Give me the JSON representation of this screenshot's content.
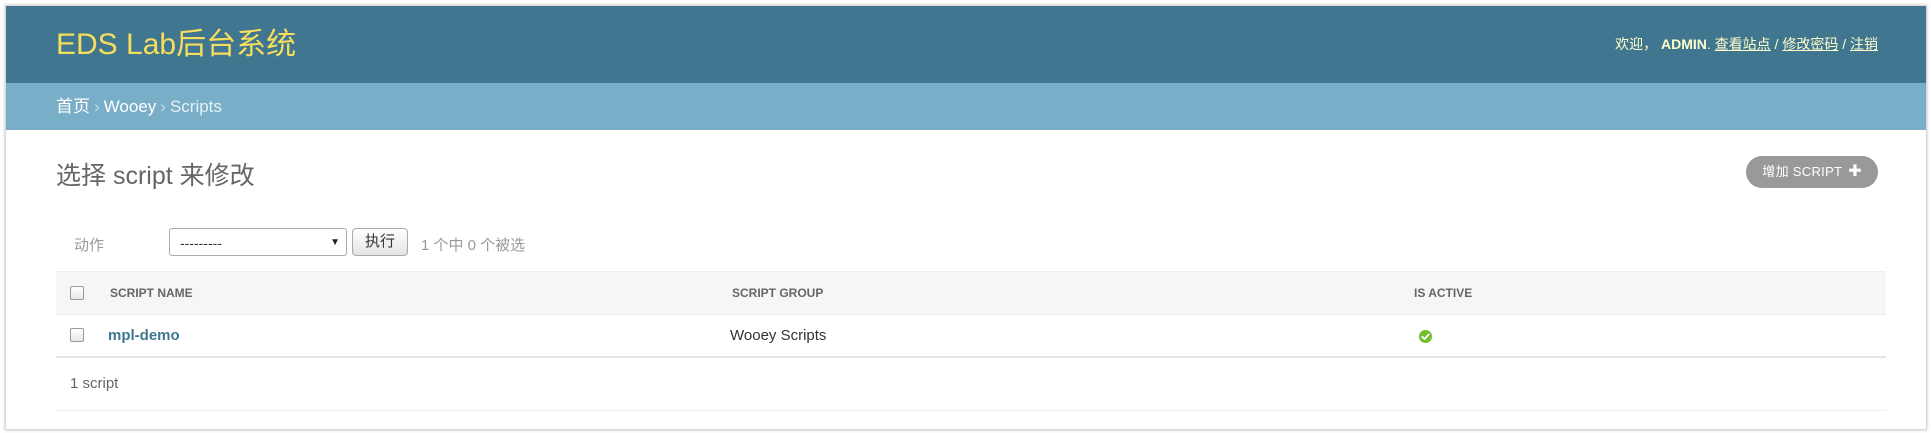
{
  "header": {
    "brand": "EDS Lab后台系统",
    "welcome": "欢迎，",
    "username": "ADMIN",
    "view_site": "查看站点",
    "change_password": "修改密码",
    "logout": "注销",
    "separator": "/"
  },
  "breadcrumbs": {
    "home": "首页",
    "app": "Wooey",
    "current": "Scripts",
    "separator": "›"
  },
  "page": {
    "title": "选择 script 来修改",
    "add_button": "增加 SCRIPT",
    "add_icon": "plus-icon"
  },
  "actions": {
    "label": "动作",
    "selected_option": "---------",
    "go_label": "执行",
    "counter": "1 个中 0 个被选"
  },
  "table": {
    "columns": [
      "SCRIPT NAME",
      "SCRIPT GROUP",
      "IS ACTIVE"
    ],
    "rows": [
      {
        "script_name": "mpl-demo",
        "script_group": "Wooey Scripts",
        "is_active": true
      }
    ],
    "paginator": "1 script"
  },
  "colors": {
    "header_bg": "#417690",
    "brand": "#f5dd5d",
    "breadcrumbs_bg": "#79aec8",
    "link": "#417690",
    "active_icon": "#70bf2b"
  }
}
